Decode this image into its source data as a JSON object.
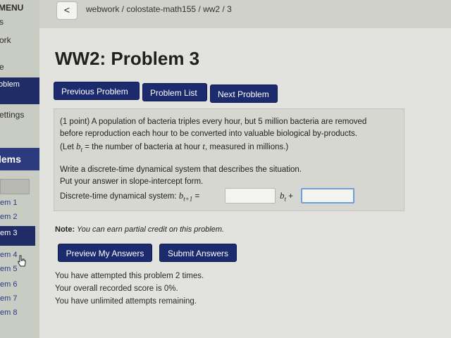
{
  "sidebar": {
    "menu_label": "MENU",
    "fragments": [
      "s",
      "ork",
      "e"
    ],
    "problem_fragment": "oblem",
    "settings_fragment": "ettings",
    "problems_header": "lems",
    "problem_items": [
      "em 1",
      "em 2",
      "em 3",
      "em 4",
      "em 5",
      "em 6",
      "em 7",
      "em 8"
    ],
    "active_index": 2
  },
  "topbar": {
    "back_icon": "chevron-left-icon",
    "back_glyph": "<",
    "breadcrumb": "webwork / colostate-math155 / ww2 / 3"
  },
  "page_title": "WW2: Problem 3",
  "nav_buttons": {
    "previous": "Previous Problem",
    "list": "Problem List",
    "next": "Next Problem"
  },
  "problem": {
    "line1": "(1 point) A population of bacteria triples every hour, but 5 million bacteria are removed",
    "line2": "before reproduction each hour to be converted into valuable biological by-products.",
    "line3_pre": "(Let ",
    "line3_var": "b",
    "line3_sub": "t",
    "line3_mid": " = the number of bacteria at hour ",
    "line3_t": "t",
    "line3_post": ", measured in millions.)",
    "line4": "Write a discrete-time dynamical system that describes the situation.",
    "line5": "Put your answer in slope-intercept form.",
    "line6_label": "Discrete-time dynamical system: ",
    "line6_lhs_var": "b",
    "line6_lhs_sub": "t+1",
    "line6_eq": " =",
    "mid_var": "b",
    "mid_sub": "t",
    "mid_plus": " +",
    "answer1_value": "",
    "answer2_value": ""
  },
  "note": {
    "label": "Note:",
    "text": " You can earn partial credit on this problem."
  },
  "action_buttons": {
    "preview": "Preview My Answers",
    "submit": "Submit Answers"
  },
  "status": {
    "attempts": "You have attempted this problem 2 times.",
    "score": "Your overall recorded score is 0%.",
    "remaining": "You have unlimited attempts remaining."
  },
  "colors": {
    "button_bg": "#1c2a6e",
    "active_input_border": "#6ca0d8",
    "sidebar_active": "#1f2c66"
  }
}
